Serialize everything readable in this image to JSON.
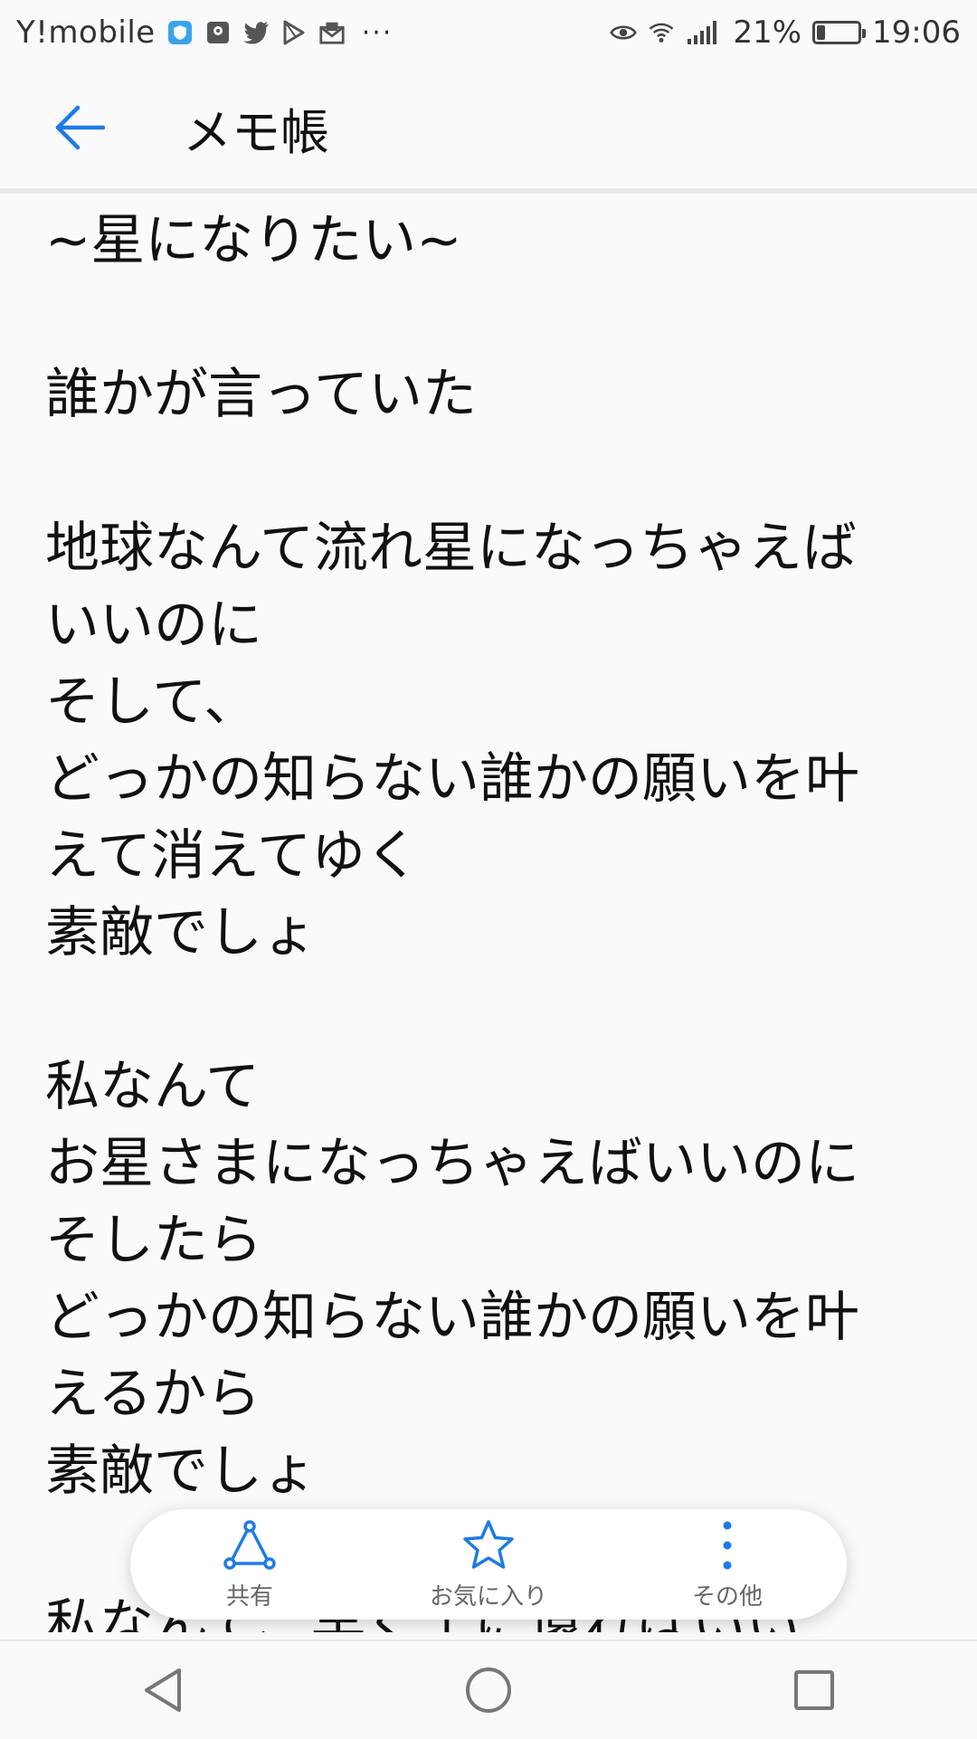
{
  "status_bar": {
    "carrier": "Y!mobile",
    "battery_percent": "21%",
    "battery_level": 0.21,
    "time": "19:06",
    "dots": "···",
    "icons_left": [
      "shield-icon",
      "maps-icon",
      "twitter-icon",
      "play-icon",
      "mail-icon"
    ],
    "icons_right": [
      "eye-icon",
      "wifi-icon",
      "signal-icon",
      "battery-icon"
    ]
  },
  "app_bar": {
    "title": "メモ帳",
    "back_icon": "back-arrow-icon",
    "accent_color": "#1e7ae6"
  },
  "note": {
    "lines": [
      "~星になりたい~",
      "",
      "誰かが言っていた",
      "",
      "地球なんて流れ星になっちゃえば",
      "いいのに",
      "そして、",
      "どっかの知らない誰かの願いを叶",
      "えて消えてゆく",
      "素敵でしょ",
      "",
      "私なんて",
      "お星さまになっちゃえばいいのに",
      "そしたら",
      "どっかの知らない誰かの願いを叶",
      "えるから",
      "素敵でしょ",
      "",
      "私なんて、早く土に還ればいい"
    ]
  },
  "toolbar": {
    "share_label": "共有",
    "favorite_label": "お気に入り",
    "more_label": "その他"
  },
  "nav_bar": {
    "back_icon": "nav-back-icon",
    "home_icon": "nav-home-icon",
    "recents_icon": "nav-recents-icon"
  }
}
